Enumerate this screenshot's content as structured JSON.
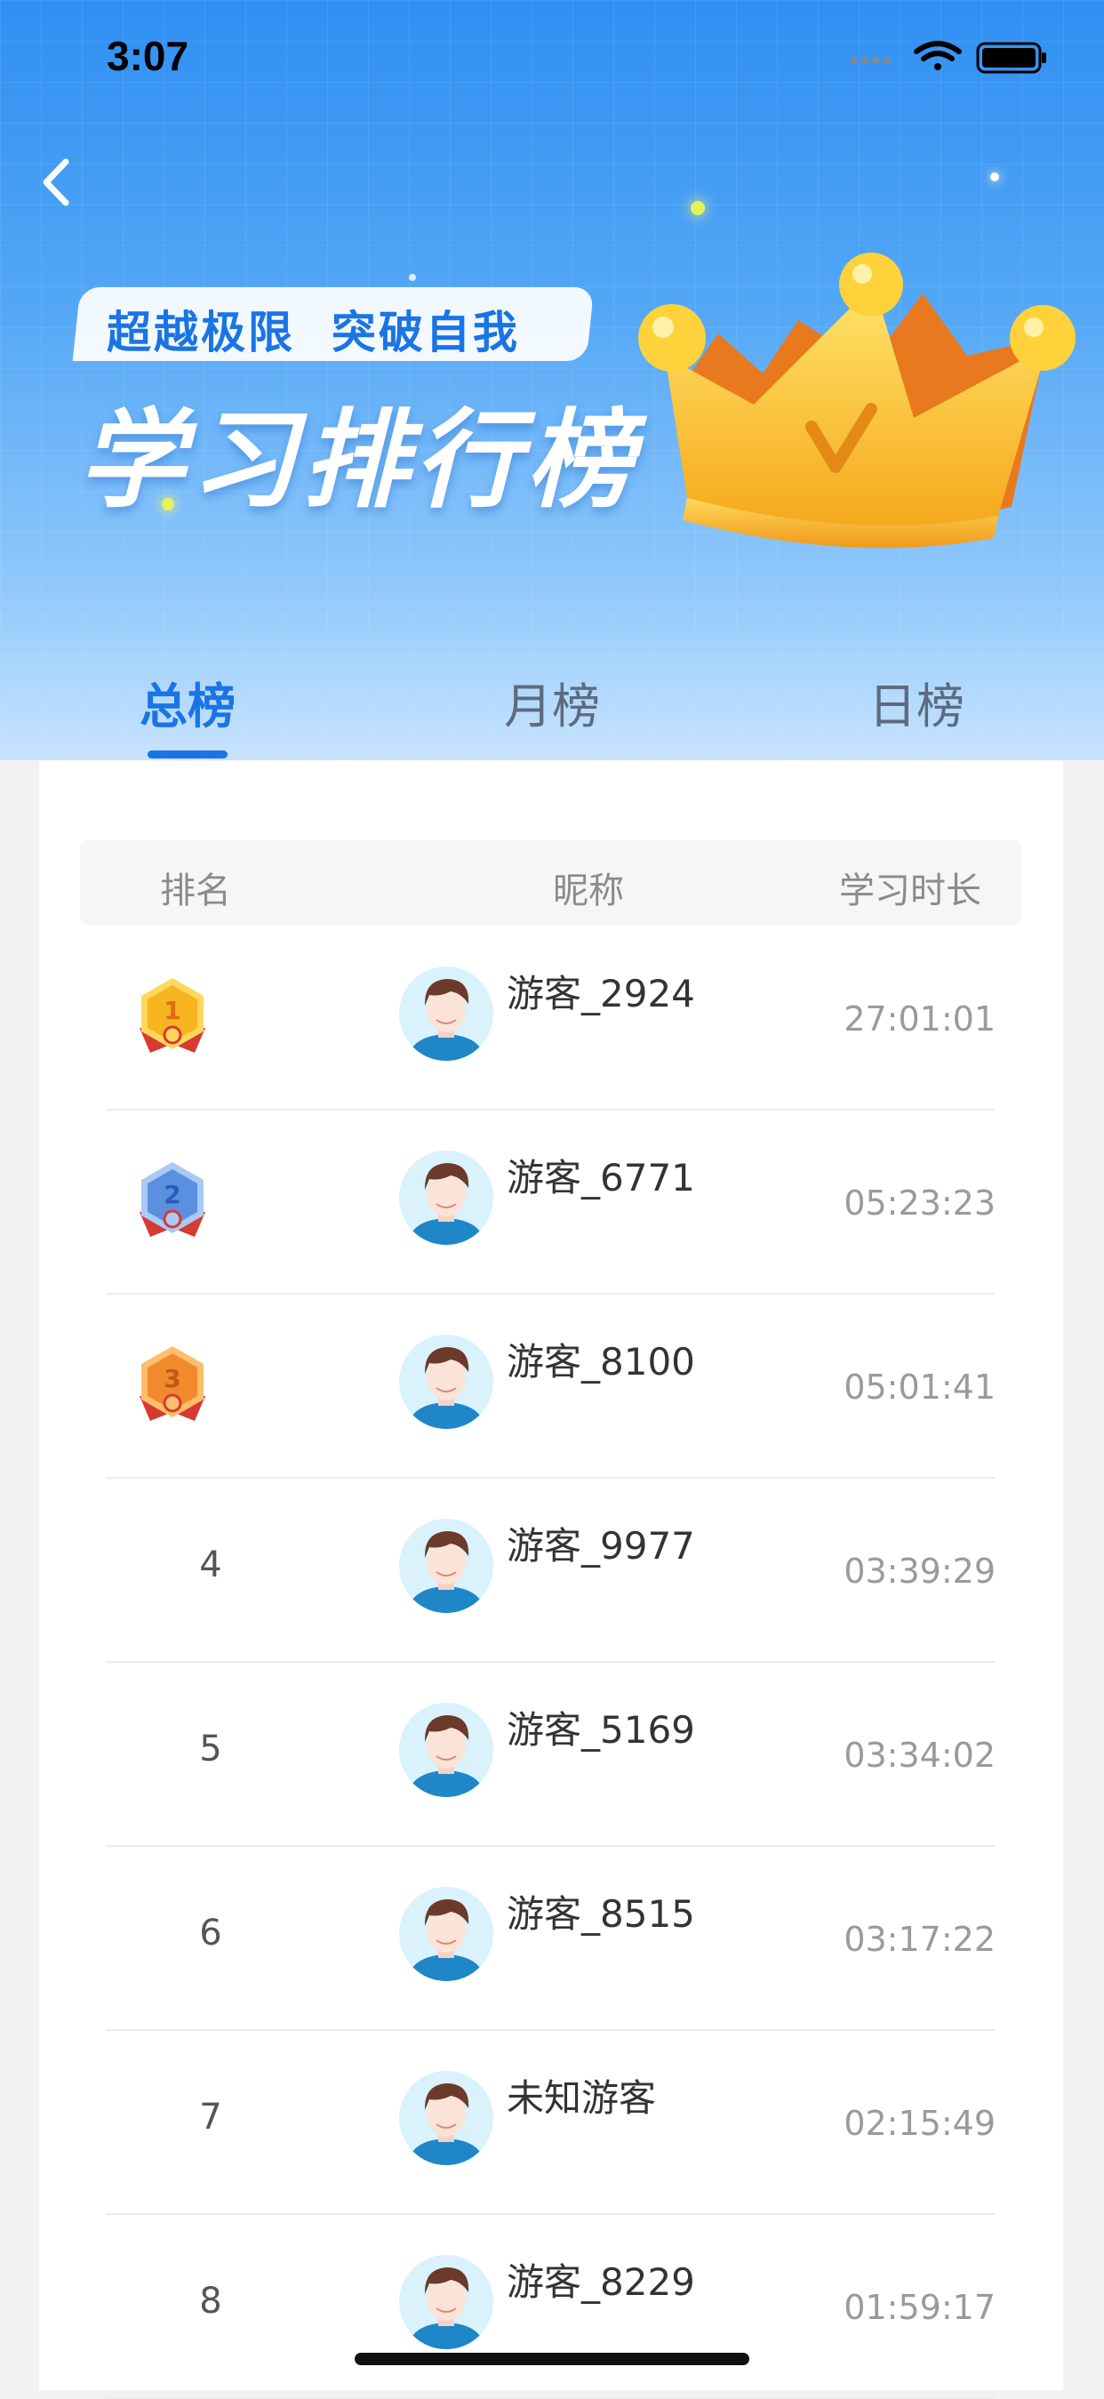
{
  "status_bar": {
    "time": "3:07"
  },
  "header": {
    "slogan": "超越极限  突破自我",
    "title": "学习排行榜"
  },
  "tabs": [
    {
      "label": "总榜",
      "active": true
    },
    {
      "label": "月榜",
      "active": false
    },
    {
      "label": "日榜",
      "active": false
    }
  ],
  "table": {
    "columns": [
      "排名",
      "昵称",
      "学习时长"
    ],
    "rows": [
      {
        "rank": "1",
        "medal": "gold",
        "name": "游客_2924",
        "duration": "27:01:01"
      },
      {
        "rank": "2",
        "medal": "silver",
        "name": "游客_6771",
        "duration": "05:23:23"
      },
      {
        "rank": "3",
        "medal": "bronze",
        "name": "游客_8100",
        "duration": "05:01:41"
      },
      {
        "rank": "4",
        "medal": null,
        "name": "游客_9977",
        "duration": "03:39:29"
      },
      {
        "rank": "5",
        "medal": null,
        "name": "游客_5169",
        "duration": "03:34:02"
      },
      {
        "rank": "6",
        "medal": null,
        "name": "游客_8515",
        "duration": "03:17:22"
      },
      {
        "rank": "7",
        "medal": null,
        "name": "未知游客",
        "duration": "02:15:49"
      },
      {
        "rank": "8",
        "medal": null,
        "name": "游客_8229",
        "duration": "01:59:17"
      }
    ]
  },
  "colors": {
    "accent": "#1a74e4",
    "gold": "#f5b420",
    "silver": "#5b8fe0",
    "bronze": "#f08a2c"
  },
  "icons": [
    "back-arrow-icon",
    "signal-icon",
    "wifi-icon",
    "battery-icon",
    "crown-icon",
    "medal-icon",
    "avatar-icon"
  ]
}
